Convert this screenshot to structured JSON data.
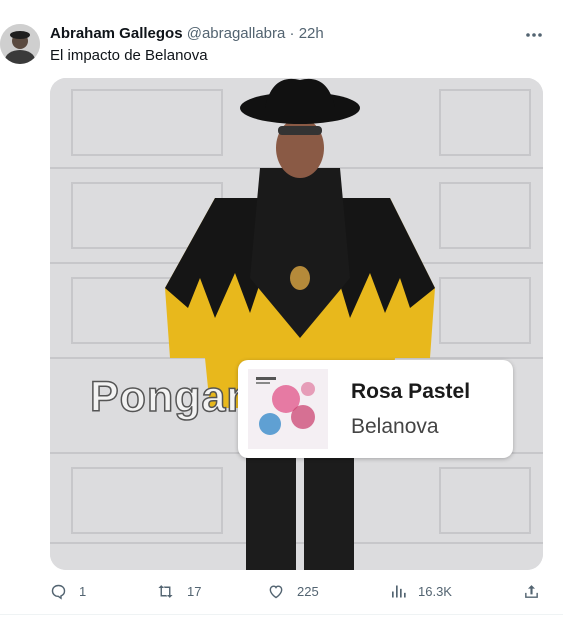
{
  "tweet": {
    "author_name": "Abraham Gallegos",
    "handle": "@abragallabra",
    "separator": "·",
    "time": "22h",
    "text": "El impacto de Belanova"
  },
  "media": {
    "overlay_text": "Pongan",
    "song_card": {
      "title": "Rosa Pastel",
      "artist": "Belanova"
    }
  },
  "actions": {
    "replies": "1",
    "retweets": "17",
    "likes": "225",
    "views": "16.3K"
  },
  "icons": [
    "more-icon",
    "reply-icon",
    "retweet-icon",
    "like-icon",
    "views-icon",
    "share-icon"
  ]
}
